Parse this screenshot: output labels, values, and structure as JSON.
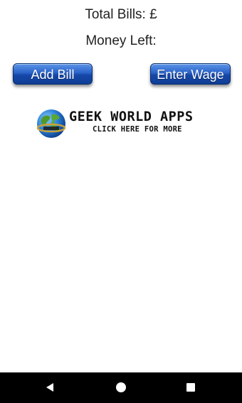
{
  "summary": {
    "total_bills": "Total Bills: £",
    "money_left": "Money Left:"
  },
  "buttons": {
    "add_bill": "Add Bill",
    "enter_wage": "Enter Wage"
  },
  "banner": {
    "brand": "GEEK WORLD APPS",
    "tagline": "CLICK HERE FOR MORE",
    "icon": "globe-logo"
  },
  "nav": {
    "back_icon": "back-triangle-icon",
    "home_icon": "home-circle-icon",
    "recents_icon": "recents-square-icon"
  },
  "colors": {
    "button": "#2a63c8",
    "nav_bar": "#000000"
  }
}
